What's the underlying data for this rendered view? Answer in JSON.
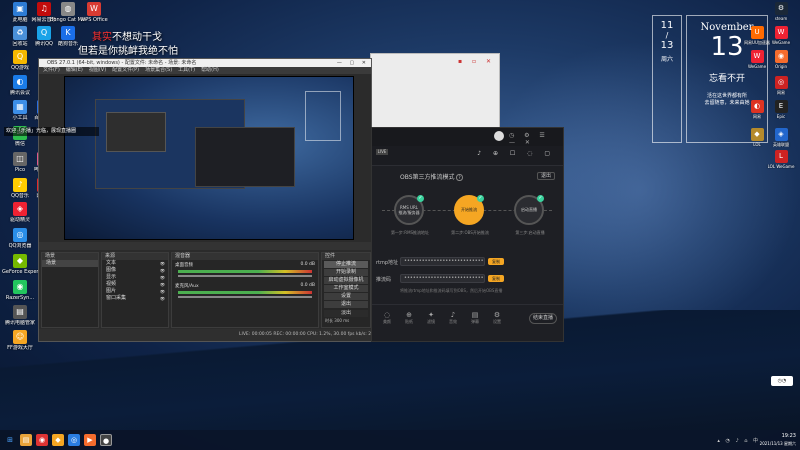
{
  "desktop_left": [
    {
      "label": "此电脑",
      "color": "#2d7cd6",
      "glyph": "▣"
    },
    {
      "label": "网易云音乐",
      "color": "#c20c0c",
      "glyph": "♫"
    },
    {
      "label": "Bongo Cat Mver.exe",
      "color": "#888",
      "glyph": "◍"
    },
    {
      "label": "WPS Office",
      "color": "#d83b32",
      "glyph": "W"
    },
    {
      "label": "回收站",
      "color": "#4a90d9",
      "glyph": "♻"
    },
    {
      "label": "腾讯QQ",
      "color": "#1aa3e8",
      "glyph": "Q"
    },
    {
      "label": "酷狗音乐",
      "color": "#1a6ee8",
      "glyph": "K"
    },
    {
      "label": "QQ游戏",
      "color": "#f5b800",
      "glyph": "Q"
    },
    {
      "label": "腾讯会议",
      "color": "#1a7be8",
      "glyph": "◐"
    },
    {
      "label": "小工具",
      "color": "#3c8ee8",
      "glyph": "▦"
    },
    {
      "label": "百度网盘",
      "color": "#2a6fe0",
      "glyph": "☁"
    },
    {
      "label": "微信",
      "color": "#2dbd4e",
      "glyph": "✉"
    },
    {
      "label": "哔哩哔哩",
      "color": "#e05a8a",
      "glyph": "▶"
    },
    {
      "label": "Pico",
      "color": "#666",
      "glyph": "◫"
    },
    {
      "label": "QQ音乐",
      "color": "#ffcc00",
      "glyph": "♪"
    },
    {
      "label": "网易云",
      "color": "#e22b2b",
      "glyph": "◉"
    },
    {
      "label": "驱动精灵",
      "color": "#e23",
      "glyph": "◈"
    },
    {
      "label": "QQ浏览器",
      "color": "#2a8ee8",
      "glyph": "◎"
    },
    {
      "label": "GeForce Experience",
      "color": "#76b900",
      "glyph": "◆"
    },
    {
      "label": "RazerSyn...",
      "color": "#22c55e",
      "glyph": "◉"
    },
    {
      "label": "腾讯电脑管家",
      "color": "#555",
      "glyph": "▤"
    },
    {
      "label": "FF游戏大厅",
      "color": "#f5a623",
      "glyph": "☺"
    }
  ],
  "desktop_right": [
    {
      "label": "steam",
      "color": "#1b2838",
      "glyph": "⚙"
    },
    {
      "label": "网易UU加速器",
      "color": "#ff6a00",
      "glyph": "U"
    },
    {
      "label": "WeGame",
      "color": "#e23",
      "glyph": "W"
    },
    {
      "label": "WeGame",
      "color": "#e23",
      "glyph": "W"
    },
    {
      "label": "Origin",
      "color": "#f56c2d",
      "glyph": "◉"
    },
    {
      "label": "网易",
      "color": "#c22",
      "glyph": "◎"
    },
    {
      "label": "网易",
      "color": "#d32",
      "glyph": "◐"
    },
    {
      "label": "Epic",
      "color": "#222",
      "glyph": "E"
    },
    {
      "label": "LOL",
      "color": "#b58a2b",
      "glyph": "◆"
    },
    {
      "label": "英雄联盟",
      "color": "#2266cc",
      "glyph": "◈"
    },
    {
      "label": "LOL WeGame",
      "color": "#c22",
      "glyph": "L"
    }
  ],
  "lyrics": {
    "line1_highlight": "其实",
    "line1_rest": "不想动干戈",
    "line2": "但若是你挑衅我绝不怕"
  },
  "clock": {
    "month": "11",
    "day": "13",
    "week": "周六"
  },
  "calendar": {
    "month": "November",
    "date": "13",
    "title": "忘看不开",
    "line1": "活在这世界都有所",
    "line2": "去留随意，未来由她"
  },
  "obs": {
    "title": "OBS 27.0.1 (64-bit, windows) - 配置文件: 未命名 - 场景: 未命名",
    "menu": [
      "文件(F)",
      "编辑(E)",
      "视图(V)",
      "配置文件(P)",
      "场景集合(S)",
      "工具(T)",
      "帮助(H)"
    ],
    "scene_label": "场景",
    "source_label": "来源",
    "mixer_label": "混音器",
    "transitions_label": "场景过渡",
    "controls_label": "控件",
    "sources": [
      "文本",
      "图像",
      "显示",
      "视频",
      "图片",
      "窗口采集"
    ],
    "mixer": [
      {
        "name": "桌面音频",
        "db": "0.0 dB"
      },
      {
        "name": "麦克风/Aux",
        "db": "0.0 dB"
      }
    ],
    "controls": [
      "停止推流",
      "开始录制",
      "启动虚拟摄像机",
      "工作室模式",
      "设置",
      "退出"
    ],
    "transition": "淡出",
    "duration_label": "时长",
    "duration": "300 ms",
    "status": "LIVE: 00:00:05  REC: 00:00:00  CPU: 1.2%, 30.00 fps  kb/s: 2650",
    "welcome": "欢迎「乐播」光临，展现直播圈"
  },
  "companion": {
    "mode_title": "OBS第三方推流模式",
    "help": "?",
    "exit": "退出",
    "steps": [
      {
        "name": "RMS URL",
        "sub": "推流/服务器",
        "desc": "第一步:RMS推流地址"
      },
      {
        "name": "开始推流",
        "sub": "",
        "desc": "第二步:OBS开始推流"
      },
      {
        "name": "启动直播",
        "sub": "",
        "desc": "第三步:启动直播"
      }
    ],
    "rtmp_label": "rtmp地址",
    "rtmp_value": "••••••••••••••••••••••••••••••••",
    "key_label": "推流码",
    "key_value": "••••••••••••••••••••••••••••••",
    "copy": "复制",
    "note": "将推流rtmp地址和推流码填写到OBS，然后开始OBS直播",
    "tools": [
      "美颜",
      "贴纸",
      "滤镜",
      "音效",
      "弹幕",
      "设置"
    ],
    "start_btn": "结束直播"
  },
  "taskbar": {
    "time": "19:23",
    "date": "2021/11/13 星期六"
  }
}
